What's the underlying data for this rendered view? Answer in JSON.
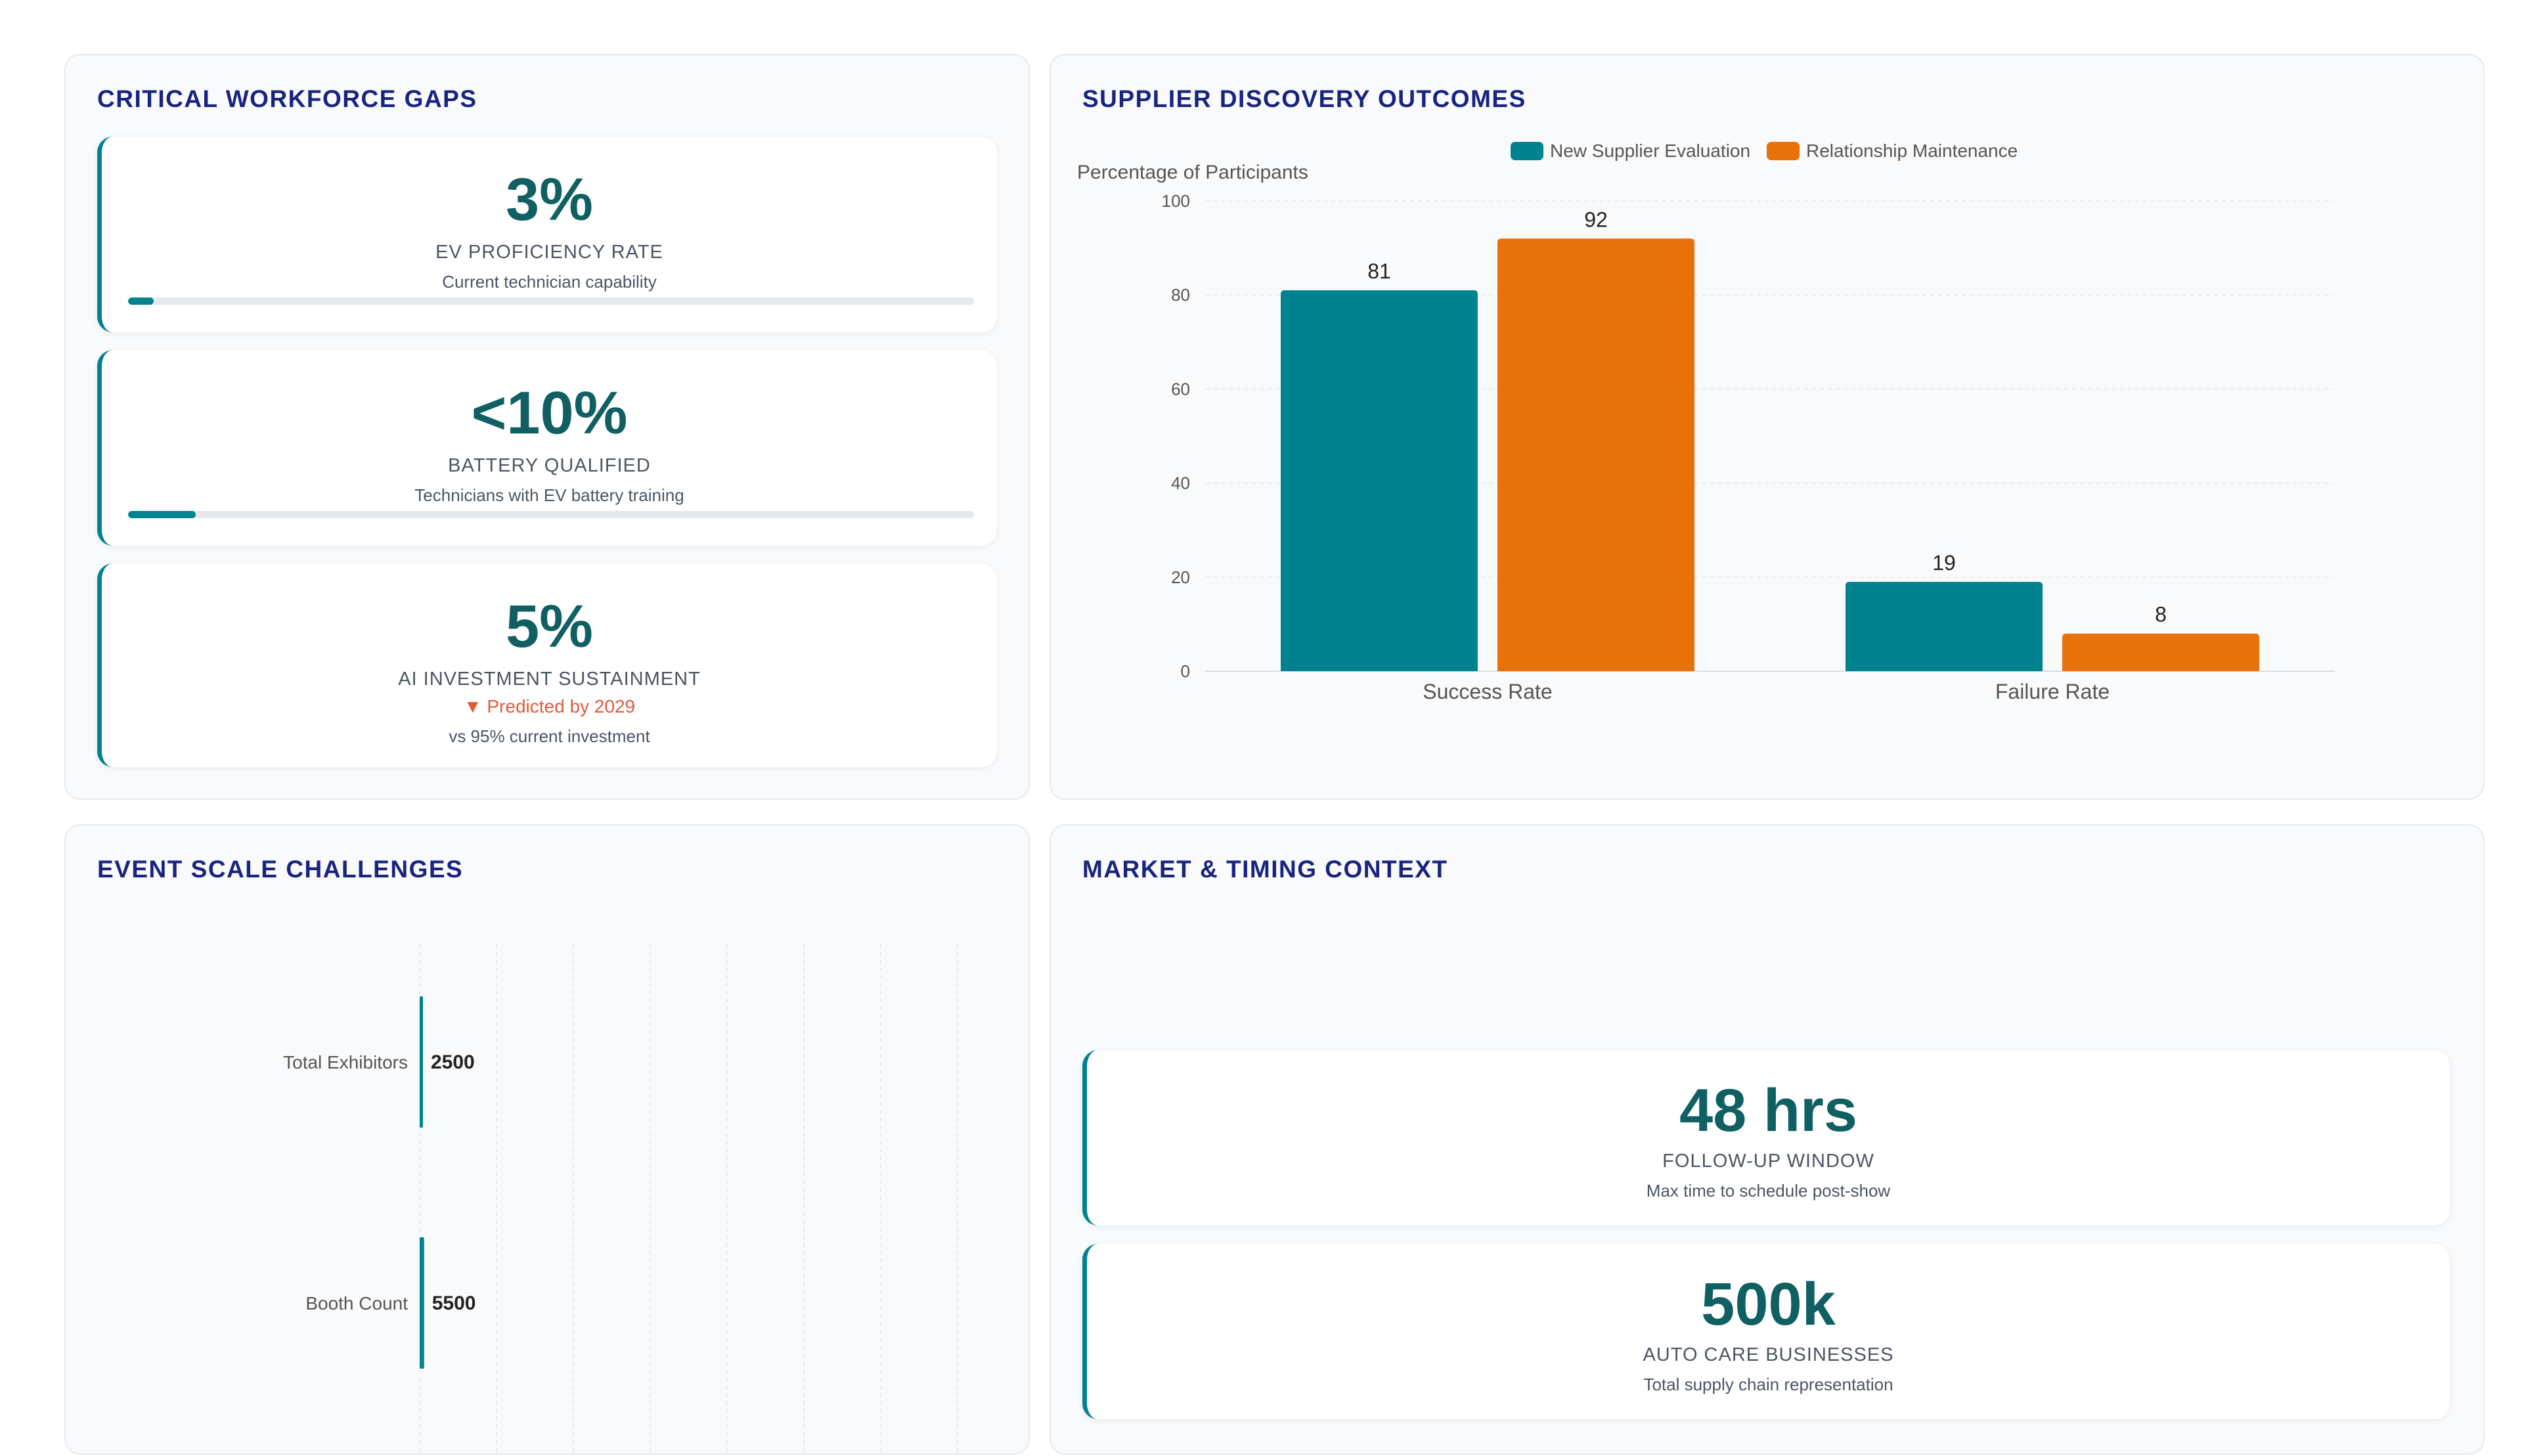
{
  "colors": {
    "teal": "#00838f",
    "orange": "#e8710a",
    "title": "#1a237e",
    "stat": "#0f5f63",
    "warning": "#e05a3c"
  },
  "workforce": {
    "title": "CRITICAL WORKFORCE GAPS",
    "cards": [
      {
        "value": "3%",
        "label": "EV PROFICIENCY RATE",
        "sub": "Current technician capability",
        "progress_percent": 3
      },
      {
        "value": "<10%",
        "label": "BATTERY QUALIFIED",
        "sub": "Technicians with EV battery training",
        "progress_percent": 8
      },
      {
        "value": "5%",
        "label": "AI INVESTMENT SUSTAINMENT",
        "warning_icon": "triangle-down-icon",
        "warning": "▼ Predicted by 2029",
        "sub": "vs 95% current investment"
      }
    ]
  },
  "supplier": {
    "title": "SUPPLIER DISCOVERY OUTCOMES"
  },
  "event": {
    "title": "EVENT SCALE CHALLENGES"
  },
  "market": {
    "title": "MARKET & TIMING CONTEXT",
    "cards": [
      {
        "value": "48 hrs",
        "label": "FOLLOW-UP WINDOW",
        "sub": "Max time to schedule post-show"
      },
      {
        "value": "500k",
        "label": "AUTO CARE BUSINESSES",
        "sub": "Total supply chain representation"
      }
    ]
  },
  "chart_data": [
    {
      "type": "bar",
      "categories": [
        "Success Rate",
        "Failure Rate"
      ],
      "series": [
        {
          "name": "New Supplier Evaluation",
          "values": [
            81,
            19
          ],
          "color": "#00838f"
        },
        {
          "name": "Relationship Maintenance",
          "values": [
            92,
            8
          ],
          "color": "#e8710a"
        }
      ],
      "ylabel": "Percentage of Participants",
      "ylim": [
        0,
        100
      ],
      "yticks": [
        0,
        20,
        40,
        60,
        80,
        100
      ],
      "legend": "top",
      "grid": true,
      "data_labels": true
    },
    {
      "type": "bar",
      "orientation": "horizontal",
      "categories": [
        "Total Exhibitors",
        "Booth Count"
      ],
      "values": [
        2500,
        5500
      ],
      "grid": true,
      "data_labels": true
    }
  ]
}
